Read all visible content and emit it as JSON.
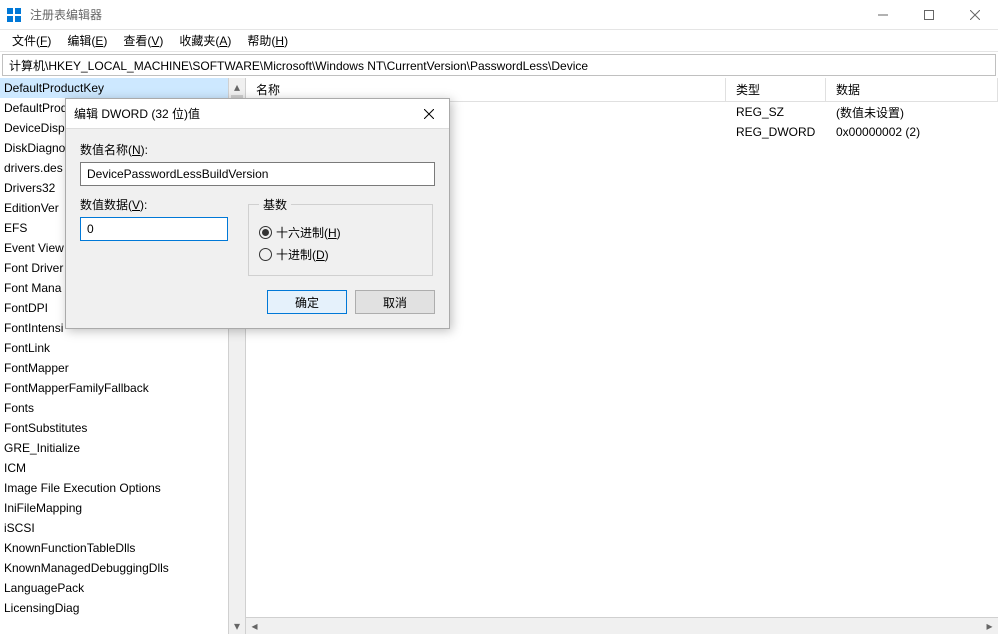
{
  "window": {
    "title": "注册表编辑器"
  },
  "menu": {
    "file": "文件(",
    "file_k": "F",
    "file_end": ")",
    "edit": "编辑(",
    "edit_k": "E",
    "edit_end": ")",
    "view": "查看(",
    "view_k": "V",
    "view_end": ")",
    "fav": "收藏夹(",
    "fav_k": "A",
    "fav_end": ")",
    "help": "帮助(",
    "help_k": "H",
    "help_end": ")"
  },
  "address": "计算机\\HKEY_LOCAL_MACHINE\\SOFTWARE\\Microsoft\\Windows NT\\CurrentVersion\\PasswordLess\\Device",
  "tree": {
    "items": [
      "DefaultProductKey",
      "DefaultProd",
      "DeviceDisp",
      "DiskDiagno",
      "drivers.des",
      "Drivers32",
      "EditionVer",
      "EFS",
      "Event View",
      "Font Driver",
      "Font Mana",
      "FontDPI",
      "FontIntensi",
      "FontLink",
      "FontMapper",
      "FontMapperFamilyFallback",
      "Fonts",
      "FontSubstitutes",
      "GRE_Initialize",
      "ICM",
      "Image File Execution Options",
      "IniFileMapping",
      "iSCSI",
      "KnownFunctionTableDlls",
      "KnownManagedDebuggingDlls",
      "LanguagePack",
      "LicensingDiag"
    ]
  },
  "columns": {
    "name": "名称",
    "type": "类型",
    "data": "数据"
  },
  "values": [
    {
      "name": "",
      "type": "REG_SZ",
      "data": "(数值未设置)"
    },
    {
      "name": "",
      "type": "REG_DWORD",
      "data": "0x00000002 (2)"
    }
  ],
  "dialog": {
    "title": "编辑 DWORD (32 位)值",
    "name_label": "数值名称(",
    "name_k": "N",
    "name_end": "):",
    "name_value": "DevicePasswordLessBuildVersion",
    "data_label": "数值数据(",
    "data_k": "V",
    "data_end": "):",
    "data_value": "0",
    "base_label": "基数",
    "hex": "十六进制(",
    "hex_k": "H",
    "hex_end": ")",
    "dec": "十进制(",
    "dec_k": "D",
    "dec_end": ")",
    "ok": "确定",
    "cancel": "取消"
  }
}
